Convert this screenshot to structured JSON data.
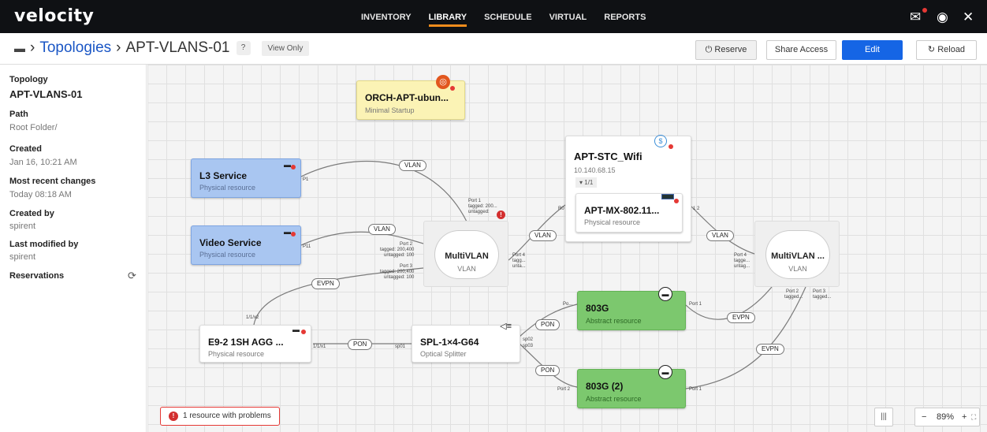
{
  "app": {
    "logo": "velocity"
  },
  "nav": {
    "items": [
      "INVENTORY",
      "LIBRARY",
      "SCHEDULE",
      "VIRTUAL",
      "REPORTS"
    ],
    "active": "LIBRARY"
  },
  "breadcrumb": {
    "icon": "folder-icon",
    "section": "Topologies",
    "current": "APT-VLANS-01",
    "help": "?",
    "mode": "View Only"
  },
  "toolbar": {
    "reserve": "⏻ Reserve",
    "share": "Share Access",
    "edit": "Edit",
    "reload": "↻ Reload"
  },
  "sidebar": {
    "topology_label": "Topology",
    "topology_value": "APT-VLANS-01",
    "path_label": "Path",
    "path_value": "Root Folder/",
    "created_label": "Created",
    "created_value": "Jan 16, 10:21 AM",
    "recent_label": "Most recent changes",
    "recent_value": "Today 08:18 AM",
    "createdby_label": "Created by",
    "createdby_value": "spirent",
    "modifiedby_label": "Last modified by",
    "modifiedby_value": "spirent",
    "reservations_label": "Reservations"
  },
  "nodes": {
    "orch": {
      "title": "ORCH-APT-ubun...",
      "sub": "Minimal Startup"
    },
    "l3": {
      "title": "L3 Service",
      "sub": "Physical resource"
    },
    "video": {
      "title": "Video Service",
      "sub": "Physical resource"
    },
    "stc": {
      "title": "APT-STC_Wifi",
      "ip": "10.140.68.15",
      "tag": "▾ 1/1"
    },
    "mx": {
      "title": "APT-MX-802.11...",
      "sub": "Physical resource"
    },
    "mvlan1": {
      "title": "MultiVLAN",
      "sub": "VLAN"
    },
    "mvlan2": {
      "title": "MultiVLAN ...",
      "sub": "VLAN"
    },
    "e9": {
      "title": "E9-2 1SH AGG ...",
      "sub": "Physical resource"
    },
    "spl": {
      "title": "SPL-1×4-G64",
      "sub": "Optical Splitter"
    },
    "g803": {
      "title": "803G",
      "sub": "Abstract resource"
    },
    "g803b": {
      "title": "803G (2)",
      "sub": "Abstract resource"
    }
  },
  "links": {
    "vlan1": "VLAN",
    "vlan2": "VLAN",
    "vlan3": "VLAN",
    "vlan4": "VLAN",
    "evpn1": "EVPN",
    "evpn2": "EVPN",
    "evpn3": "EVPN",
    "pon1": "PON",
    "pon2": "PON",
    "pon3": "PON"
  },
  "ports": {
    "p1": "P1",
    "p11": "P11",
    "port1_a": "Port 1",
    "port1_a_t": "tagged: 200...",
    "port1_a_u": "untagged:",
    "port2_a": "Port 2",
    "port2_a_t": "tagged: 200,400",
    "port2_a_u": "untagged: 100",
    "port3_a": "Port 3",
    "port3_a_t": "tagged: 200,400",
    "port3_a_u": "untagged: 100",
    "port4_a": "Port 4",
    "port4_a_t": "tagg...",
    "port4_a_u": "unta...",
    "port4_b": "Port 4",
    "port4_b_t": "tagge...",
    "port4_b_u": "untag...",
    "port2_b": "Port 2",
    "port2_b_t": "tagged...",
    "port3_b": "Port 3",
    "port3_b_t": "tagged...",
    "stc_left": "R0",
    "stc_right": "1 2",
    "e9_top": "1/1/x2",
    "e9_right": "1/1/x1",
    "spl_left": "sp01",
    "spl_r1": "sp02",
    "spl_r2": "sp03",
    "g803_left": "Po...",
    "g803_right": "Port 1",
    "g803b_left": "Port 2",
    "g803b_right": "Port 1"
  },
  "status": {
    "problems": "1 resource with problems"
  },
  "zoom": {
    "minus": "−",
    "value": "89%",
    "plus": "+"
  },
  "colors": {
    "accent": "#1565e5",
    "nav_active": "#f08c1c",
    "error": "#e53935",
    "blue_node": "#a9c6f1",
    "green_node": "#7cc86e",
    "yellow_node": "#fbf3b5"
  }
}
